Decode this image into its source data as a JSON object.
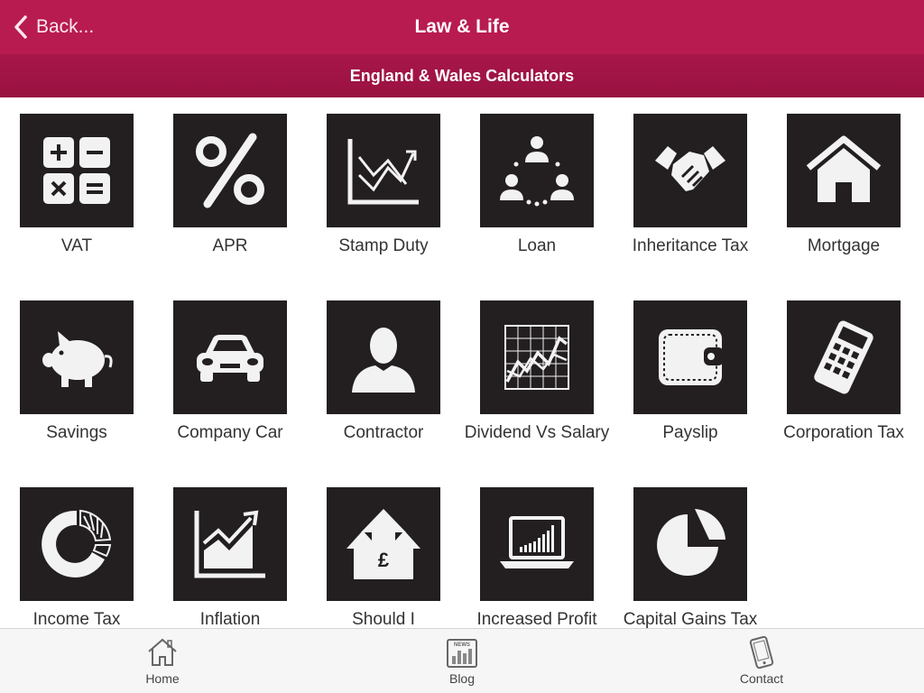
{
  "header": {
    "back_label": "Back...",
    "title": "Law & Life",
    "subtitle": "England & Wales Calculators"
  },
  "colors": {
    "header_bg": "#b81b4f",
    "subheader_bg": "#a31547",
    "tile_bg": "#231f20",
    "icon_fg": "#f2f2f2",
    "tabbar_bg": "#f6f6f6"
  },
  "calculators": [
    {
      "label": "VAT",
      "icon": "calculator-keys-icon"
    },
    {
      "label": "APR",
      "icon": "percent-icon"
    },
    {
      "label": "Stamp Duty",
      "icon": "trend-chart-icon"
    },
    {
      "label": "Loan",
      "icon": "people-cycle-icon"
    },
    {
      "label": "Inheritance Tax",
      "icon": "handshake-icon"
    },
    {
      "label": "Mortgage",
      "icon": "house-icon"
    },
    {
      "label": "Savings",
      "icon": "piggy-bank-icon"
    },
    {
      "label": "Company Car",
      "icon": "car-icon"
    },
    {
      "label": "Contractor",
      "icon": "person-bust-icon"
    },
    {
      "label": "Dividend Vs Salary",
      "icon": "grid-chart-icon"
    },
    {
      "label": "Payslip",
      "icon": "wallet-icon"
    },
    {
      "label": "Corporation Tax",
      "icon": "handheld-calculator-icon"
    },
    {
      "label": "Income Tax",
      "icon": "donut-chart-icon"
    },
    {
      "label": "Inflation",
      "icon": "rising-chart-icon"
    },
    {
      "label": "Should I",
      "icon": "pound-arrows-icon"
    },
    {
      "label": "Increased Profit",
      "icon": "laptop-chart-icon"
    },
    {
      "label": "Capital Gains Tax",
      "icon": "pie-chart-icon"
    }
  ],
  "tabs": [
    {
      "label": "Home",
      "icon": "home-icon"
    },
    {
      "label": "Blog",
      "icon": "news-icon",
      "icon_text": "NEWS"
    },
    {
      "label": "Contact",
      "icon": "phone-icon"
    }
  ]
}
